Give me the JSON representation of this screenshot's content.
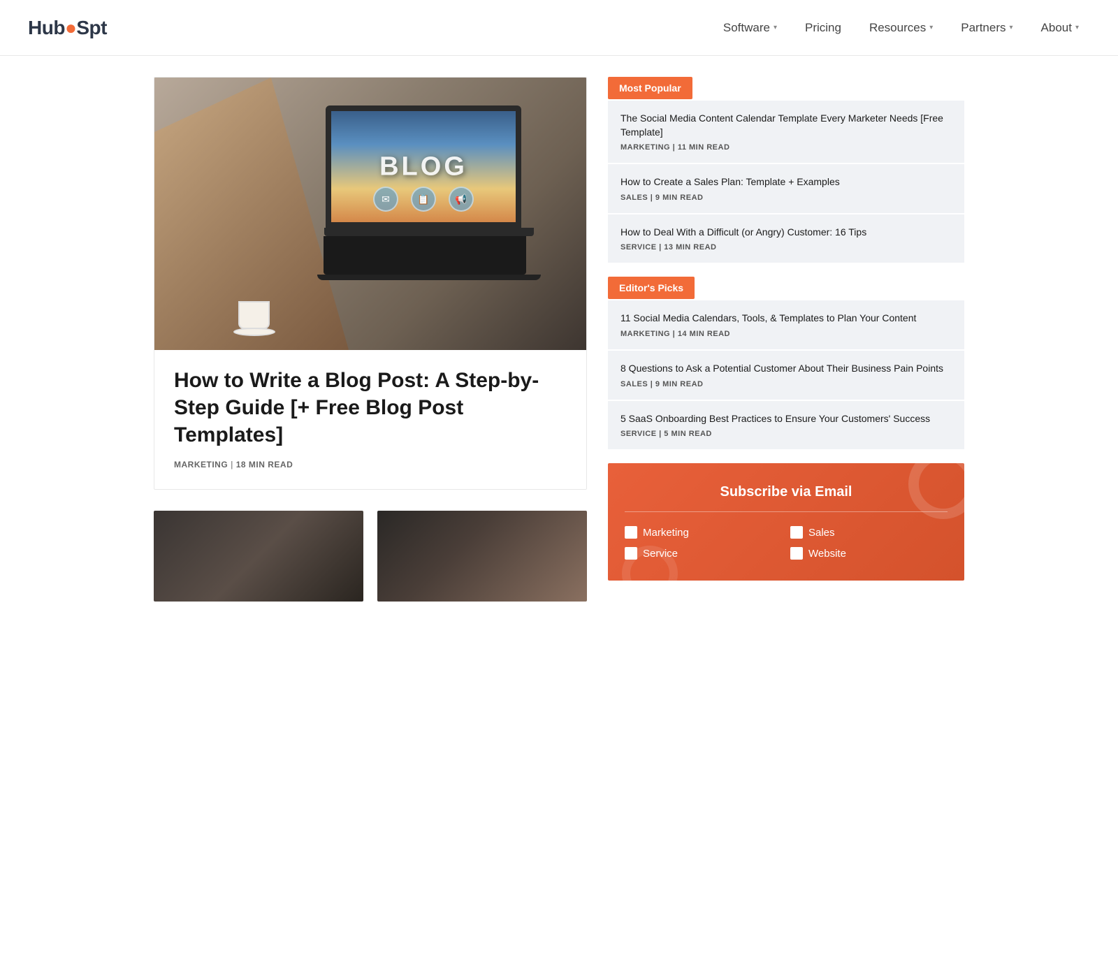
{
  "nav": {
    "logo": {
      "part1": "Hub",
      "dot": "●",
      "part2": "Sp",
      "part3": "t"
    },
    "items": [
      {
        "label": "Software",
        "hasDropdown": true
      },
      {
        "label": "Pricing",
        "hasDropdown": false
      },
      {
        "label": "Resources",
        "hasDropdown": true
      },
      {
        "label": "Partners",
        "hasDropdown": true
      },
      {
        "label": "About",
        "hasDropdown": true
      }
    ]
  },
  "hero": {
    "blog_text": "BLOG",
    "title": "How to Write a Blog Post: A Step-by-Step Guide [+ Free Blog Post Templates]",
    "category": "MARKETING",
    "read_time": "18 MIN READ",
    "separator": "|"
  },
  "sidebar": {
    "most_popular": {
      "badge": "Most Popular",
      "articles": [
        {
          "title": "The Social Media Content Calendar Template Every Marketer Needs [Free Template]",
          "category": "MARKETING",
          "read_time": "11 MIN READ"
        },
        {
          "title": "How to Create a Sales Plan: Template + Examples",
          "category": "SALES",
          "read_time": "9 MIN READ"
        },
        {
          "title": "How to Deal With a Difficult (or Angry) Customer: 16 Tips",
          "category": "SERVICE",
          "read_time": "13 MIN READ"
        }
      ]
    },
    "editors_picks": {
      "badge": "Editor's Picks",
      "articles": [
        {
          "title": "11 Social Media Calendars, Tools, & Templates to Plan Your Content",
          "category": "MARKETING",
          "read_time": "14 MIN READ"
        },
        {
          "title": "8 Questions to Ask a Potential Customer About Their Business Pain Points",
          "category": "SALES",
          "read_time": "9 MIN READ"
        },
        {
          "title": "5 SaaS Onboarding Best Practices to Ensure Your Customers' Success",
          "category": "SERVICE",
          "read_time": "5 MIN READ"
        }
      ]
    }
  },
  "subscribe": {
    "title": "Subscribe via Email",
    "checkboxes": [
      {
        "label": "Marketing"
      },
      {
        "label": "Sales"
      },
      {
        "label": "Service"
      },
      {
        "label": "Website"
      }
    ]
  },
  "bottom_articles": [
    {
      "bg_class": "img-dark-phone"
    },
    {
      "bg_class": "img-keyboard-phone"
    }
  ]
}
